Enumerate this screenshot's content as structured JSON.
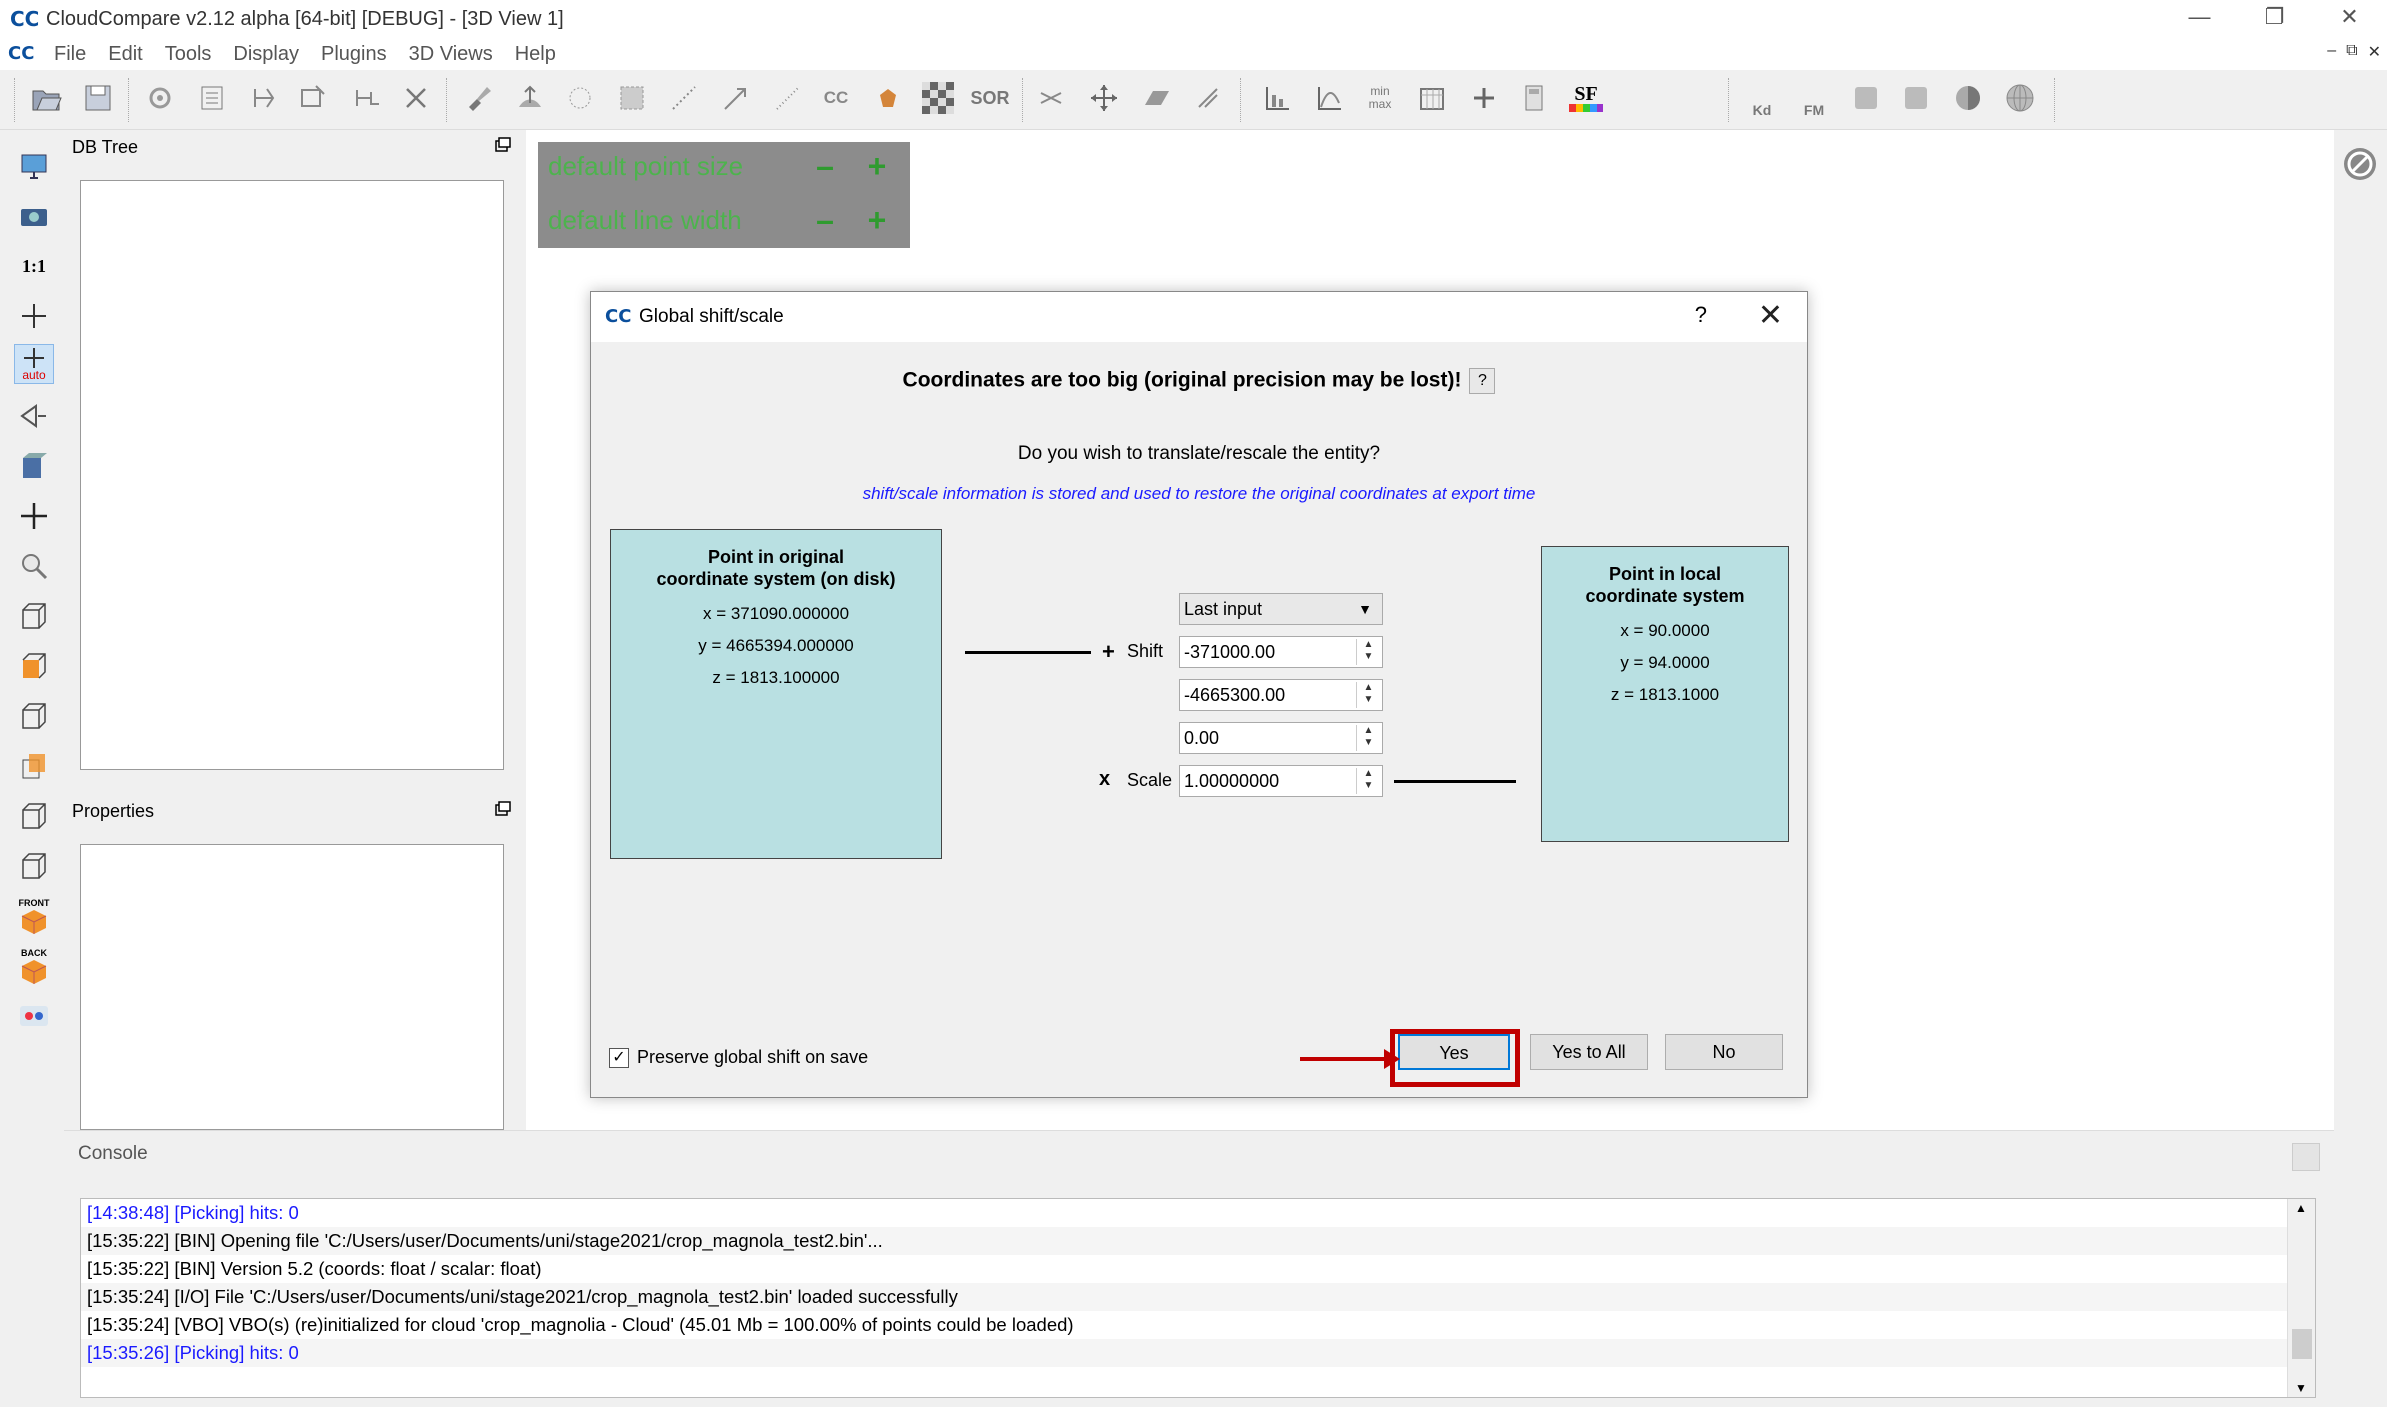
{
  "window": {
    "title": "CloudCompare v2.12 alpha [64-bit] [DEBUG] - [3D View 1]",
    "logo": "CC",
    "controls": [
      "—",
      "❐",
      "✕"
    ]
  },
  "menu": {
    "items": [
      "File",
      "Edit",
      "Tools",
      "Display",
      "Plugins",
      "3D Views",
      "Help"
    ],
    "mdi_controls": [
      "–",
      "⧉",
      "✕"
    ]
  },
  "toolbar": {
    "text_icons": {
      "cc": "CC",
      "sor": "SOR",
      "min_max": "min\nmax",
      "sf": "SF",
      "kd": "Kd",
      "fm": "FM"
    }
  },
  "vtoolbar": {
    "one_to_one": "1:1",
    "auto": "auto",
    "front": "FRONT",
    "back": "BACK"
  },
  "panels": {
    "db_tree": "DB Tree",
    "properties": "Properties"
  },
  "overlay": {
    "point_size": "default point size",
    "line_width": "default line width",
    "minus": "–",
    "plus": "+"
  },
  "dialog": {
    "title": "Global shift/scale",
    "help": "?",
    "close": "✕",
    "warning": "Coordinates are too big (original precision may be lost)!",
    "warning_help": "?",
    "question": "Do you wish to translate/rescale the entity?",
    "info": "shift/scale information is stored and used to restore the original coordinates at export time",
    "original": {
      "title_line1": "Point in original",
      "title_line2": "coordinate system (on disk)",
      "x": "x = 371090.000000",
      "y": "y = 4665394.000000",
      "z": "z = 1813.100000"
    },
    "local": {
      "title_line1": "Point in local",
      "title_line2": "coordinate system",
      "x": "x = 90.0000",
      "y": "y = 94.0000",
      "z": "z = 1813.1000"
    },
    "preset": "Last input",
    "plus_sign": "+",
    "shift_label": "Shift",
    "shift_x": "-371000.00",
    "shift_y": "-4665300.00",
    "shift_z": "0.00",
    "times_sign": "x",
    "scale_label": "Scale",
    "scale": "1.00000000",
    "preserve_label": "Preserve global shift on save",
    "preserve_checked": true,
    "buttons": {
      "yes": "Yes",
      "yes_to_all": "Yes to All",
      "no": "No"
    }
  },
  "console": {
    "title": "Console",
    "lines": [
      {
        "text": "[14:38:48] [Picking] hits: 0",
        "color": "#1a1aff"
      },
      {
        "text": "[15:35:22] [BIN] Opening file 'C:/Users/user/Documents/uni/stage2021/crop_magnola_test2.bin'...",
        "color": "#000000"
      },
      {
        "text": "[15:35:22] [BIN] Version 5.2 (coords: float / scalar: float)",
        "color": "#000000"
      },
      {
        "text": "[15:35:24] [I/O] File 'C:/Users/user/Documents/uni/stage2021/crop_magnola_test2.bin' loaded successfully",
        "color": "#000000"
      },
      {
        "text": "[15:35:24] [VBO] VBO(s) (re)initialized for cloud 'crop_magnolia - Cloud' (45.01 Mb = 100.00% of points could be loaded)",
        "color": "#000000"
      },
      {
        "text": "[15:35:26] [Picking] hits: 0",
        "color": "#1a1aff"
      }
    ]
  },
  "colors": {
    "box_fill": "#b9e0e2",
    "highlight": "#c00000",
    "info_text": "#1a1aff",
    "overlay_text": "#4db34d"
  }
}
